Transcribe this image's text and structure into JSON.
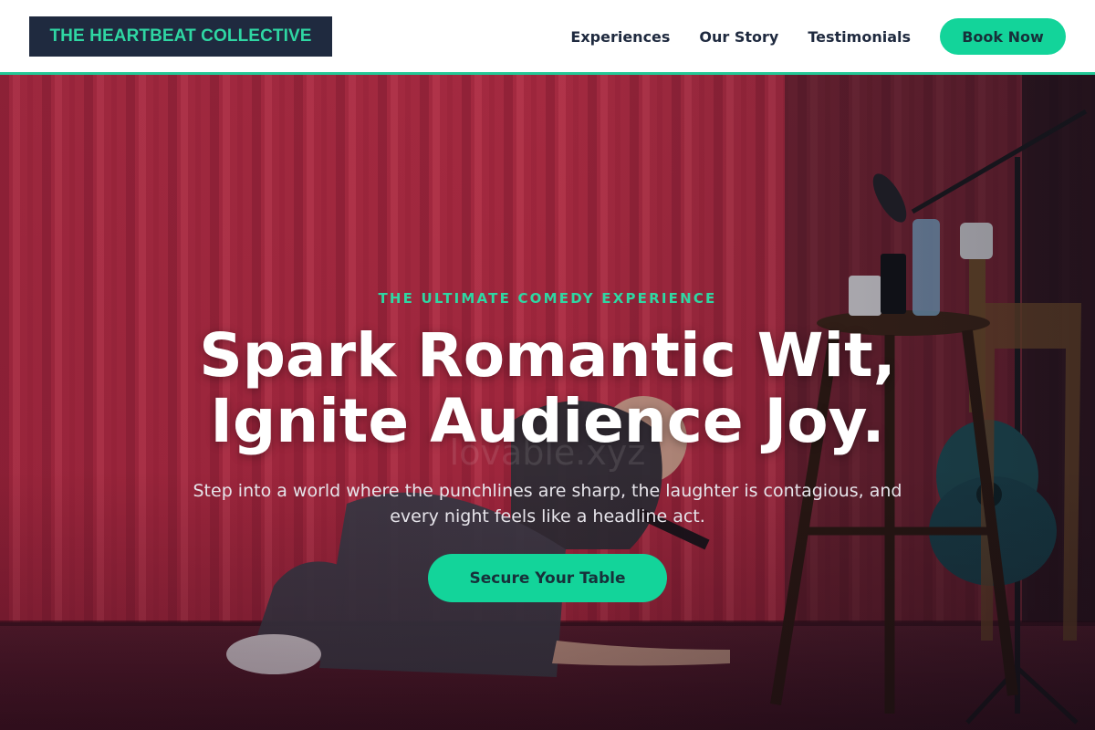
{
  "nav": {
    "logo": "THE HEARTBEAT COLLECTIVE",
    "links": [
      "Experiences",
      "Our Story",
      "Testimonials"
    ],
    "cta": "Book Now"
  },
  "hero": {
    "eyebrow": "THE ULTIMATE COMEDY EXPERIENCE",
    "headline_line1": "Spark Romantic Wit,",
    "headline_line2": "Ignite Audience Joy.",
    "subtext_line1": "Step into a world where the punchlines are sharp, the laughter is contagious, and",
    "subtext_line2": "every night feels like a headline act.",
    "cta": "Secure Your Table",
    "watermark": "lovable.xyz"
  },
  "colors": {
    "accent": "#13d49a",
    "logo_bg": "#1f2a3f",
    "curtain": "#c0334a"
  },
  "icons": [
    "microphone-icon",
    "guitar-icon",
    "stool-icon"
  ]
}
